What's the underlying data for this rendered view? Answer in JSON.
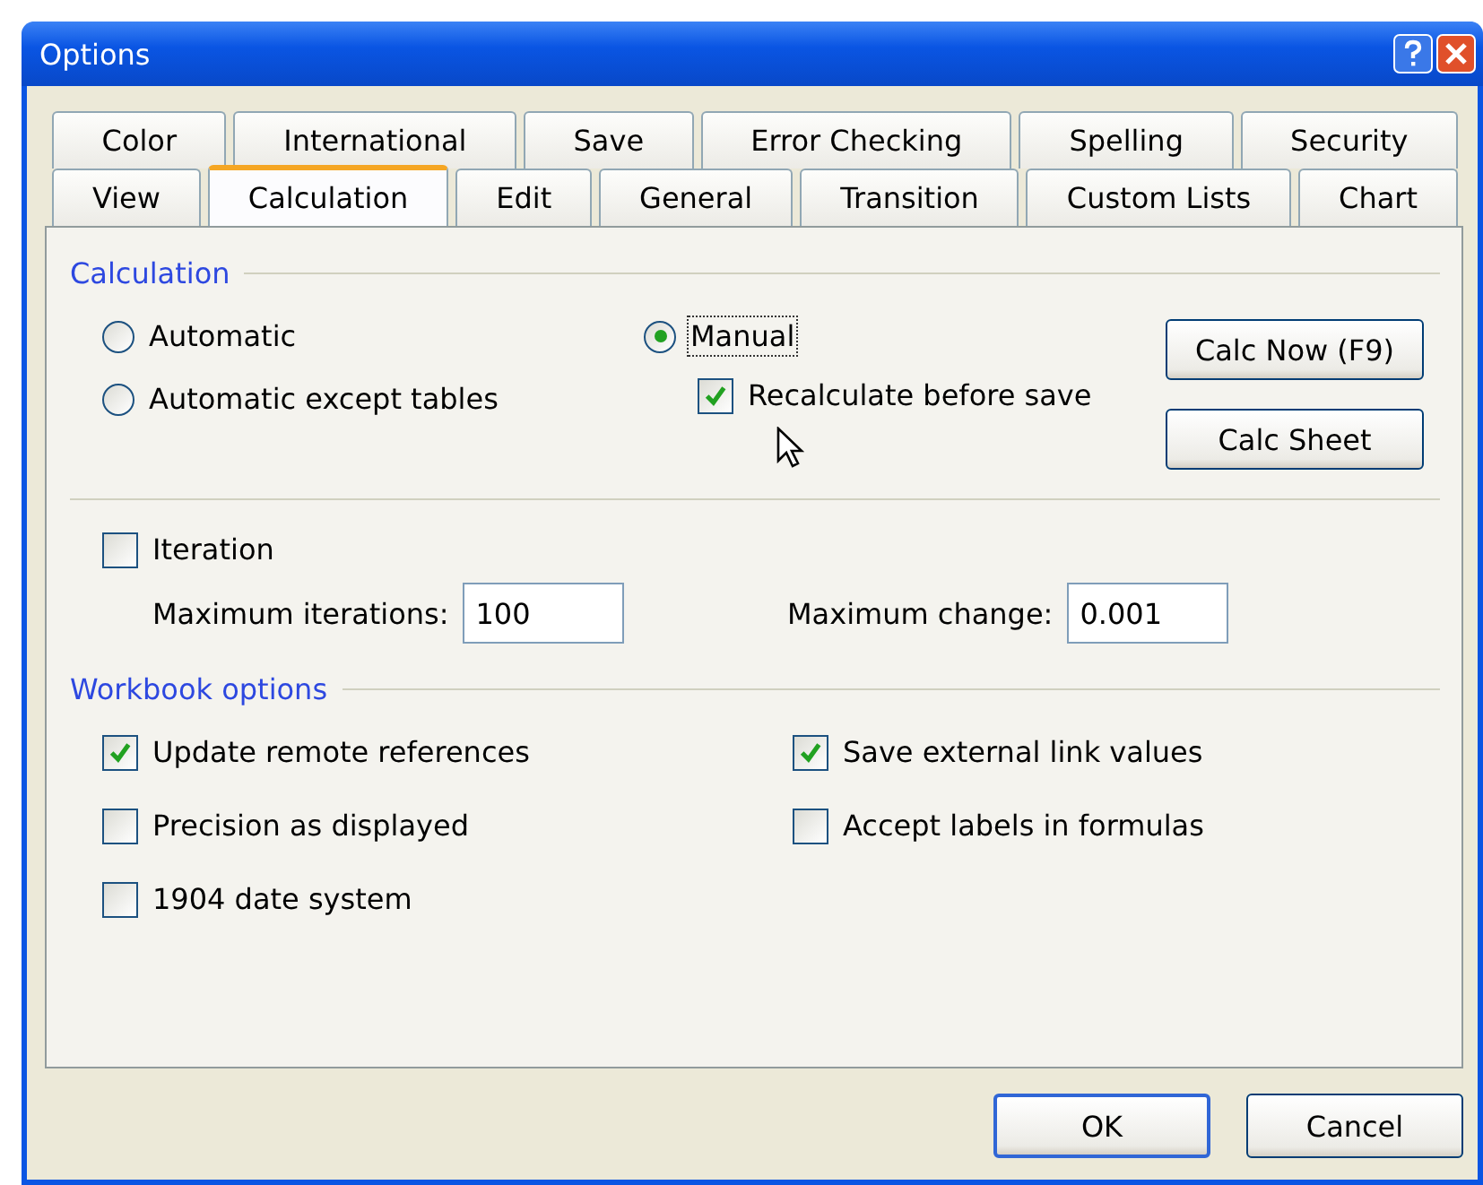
{
  "window": {
    "title": "Options"
  },
  "tabs": [
    [
      {
        "label": "Color",
        "selected": false
      },
      {
        "label": "International",
        "selected": false
      },
      {
        "label": "Save",
        "selected": false
      },
      {
        "label": "Error Checking",
        "selected": false
      },
      {
        "label": "Spelling",
        "selected": false
      },
      {
        "label": "Security",
        "selected": false
      }
    ],
    [
      {
        "label": "View",
        "selected": false
      },
      {
        "label": "Calculation",
        "selected": true
      },
      {
        "label": "Edit",
        "selected": false
      },
      {
        "label": "General",
        "selected": false
      },
      {
        "label": "Transition",
        "selected": false
      },
      {
        "label": "Custom Lists",
        "selected": false
      },
      {
        "label": "Chart",
        "selected": false
      }
    ]
  ],
  "calculation": {
    "heading": "Calculation",
    "modes": [
      {
        "label": "Automatic",
        "selected": false
      },
      {
        "label": "Automatic except tables",
        "selected": false
      },
      {
        "label": "Manual",
        "selected": true
      }
    ],
    "recalculate": {
      "label": "Recalculate before save",
      "checked": true
    },
    "buttons": [
      "Calc Now (F9)",
      "Calc Sheet"
    ],
    "iteration": {
      "label": "Iteration",
      "checked": false
    },
    "fields": [
      {
        "label": "Maximum iterations:",
        "value": "100"
      },
      {
        "label": "Maximum change:",
        "value": "0.001"
      }
    ]
  },
  "workbook": {
    "heading": "Workbook options",
    "options": [
      {
        "label": "Update remote references",
        "checked": true
      },
      {
        "label": "Save external link values",
        "checked": true
      },
      {
        "label": "Precision as displayed",
        "checked": false
      },
      {
        "label": "Accept labels in formulas",
        "checked": false
      },
      {
        "label": "1904 date system",
        "checked": false
      }
    ]
  },
  "buttons": [
    "OK",
    "Cancel"
  ]
}
